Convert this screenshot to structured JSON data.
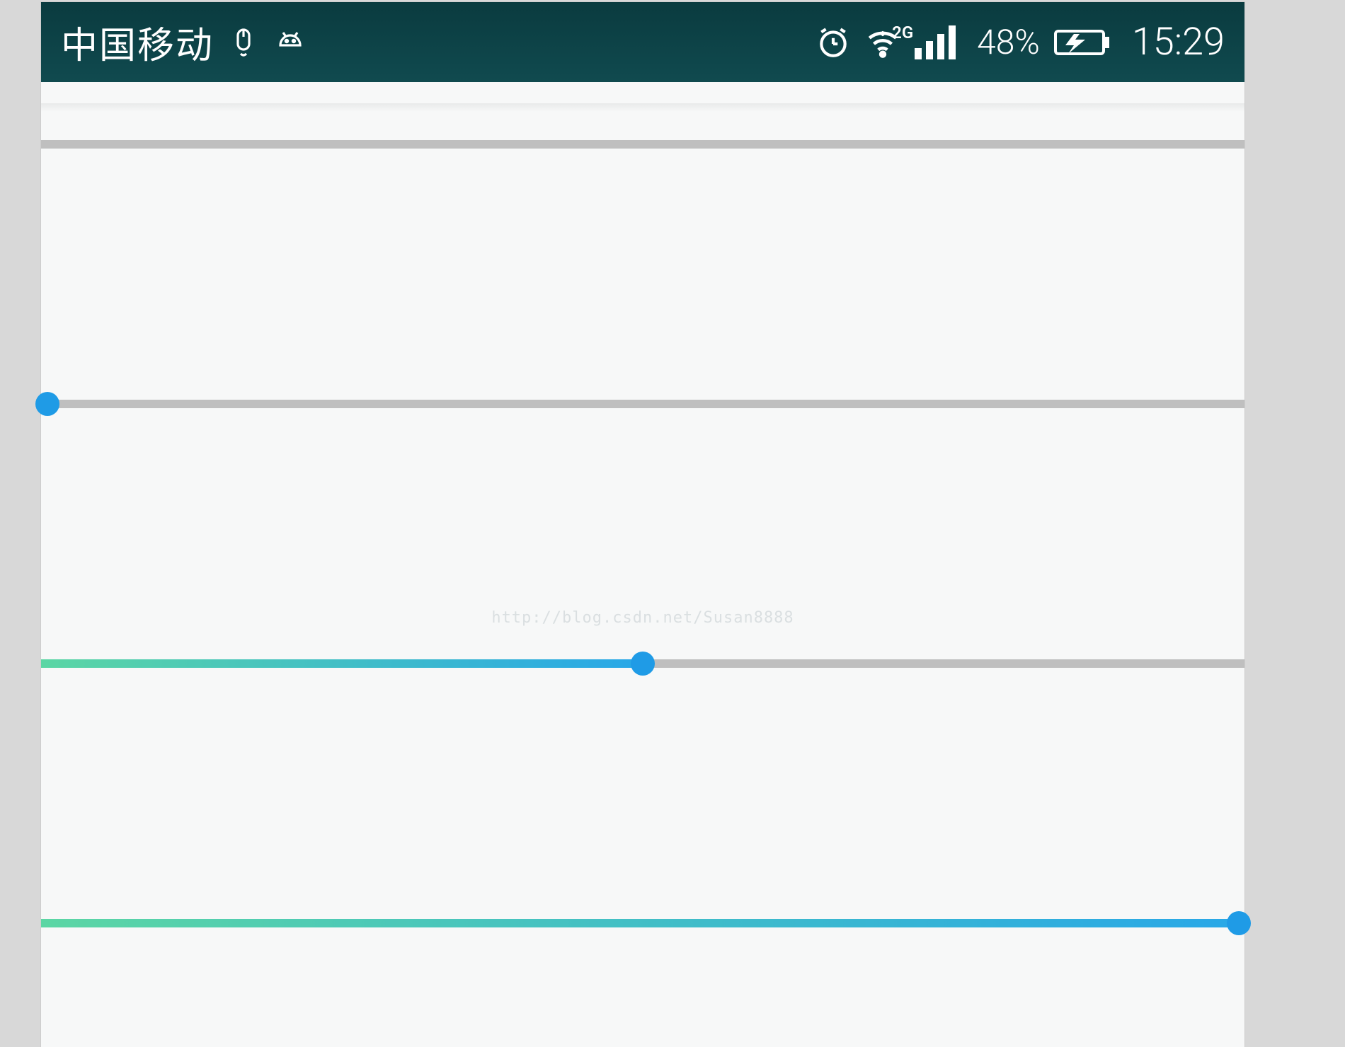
{
  "status_bar": {
    "carrier": "中国移动",
    "mouse_icon": "mouse-icon",
    "android_icon": "android-icon",
    "alarm_icon": "alarm-icon",
    "wifi_icon": "wifi-icon",
    "signal_label": "2G",
    "battery_percent": "48%",
    "time": "15:29"
  },
  "sliders": {
    "progress_bar": {
      "value": 0,
      "max": 100
    },
    "seekbar_1": {
      "value": 0,
      "max": 100
    },
    "seekbar_2": {
      "value": 50,
      "max": 100
    },
    "seekbar_3": {
      "value": 100,
      "max": 100
    }
  },
  "colors": {
    "status_bar_bg": "#104a4f",
    "track": "#bfbfbf",
    "fill_gradient_start": "#5bd6a4",
    "fill_gradient_end": "#28a7e8",
    "thumb": "#1f9be6"
  },
  "watermark": "http://blog.csdn.net/Susan8888"
}
